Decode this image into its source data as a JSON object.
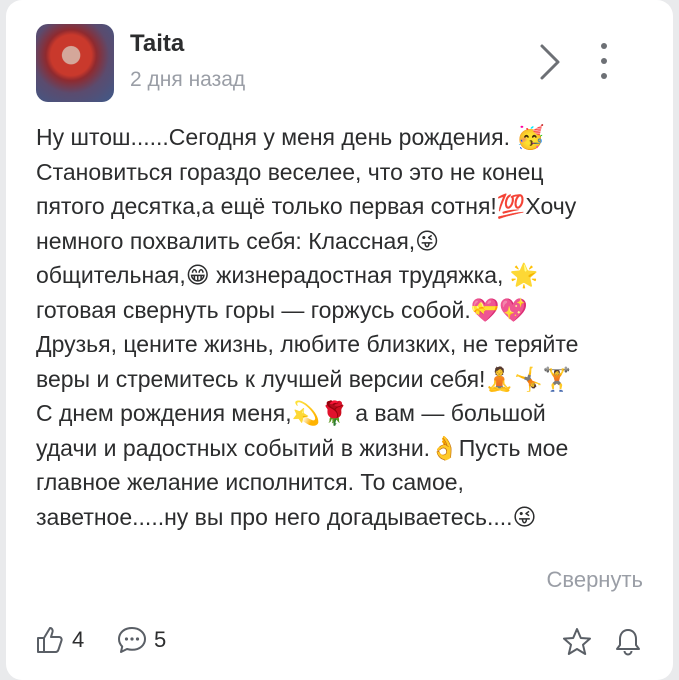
{
  "post": {
    "author": "Taita",
    "time": "2 дня назад",
    "text": "Ну штош......Сегодня у меня день рождения. 🥳\nСтановиться гораздо веселее, что это не конец\nпятого десятка,а ещё только первая сотня!💯Хочу\nнемного похвалить себя: Классная,😜\nобщительная,😁 жизнерадостная трудяжка, 🌟\nготовая свернуть горы — горжусь собой.💝💖\nДрузья, цените жизнь, любите близких, не теряйте\nверы и стремитесь к лучшей версии себя!🧘🤸🏋\nС днем рождения меня,💫🌹 а вам — большой\nудачи и радостных событий в жизни.👌Пусть мое\nглавное желание исполнится. То самое,\nзаветное.....ну вы про него догадываетесь....😜",
    "collapse_label": "Свернуть"
  },
  "footer": {
    "likes": "4",
    "comments": "5"
  },
  "icons": {
    "chevron": "chevron-right-icon",
    "more": "more-vertical-icon",
    "like": "thumbs-up-icon",
    "comment": "comment-icon",
    "bookmark": "star-icon",
    "notify": "bell-icon"
  }
}
